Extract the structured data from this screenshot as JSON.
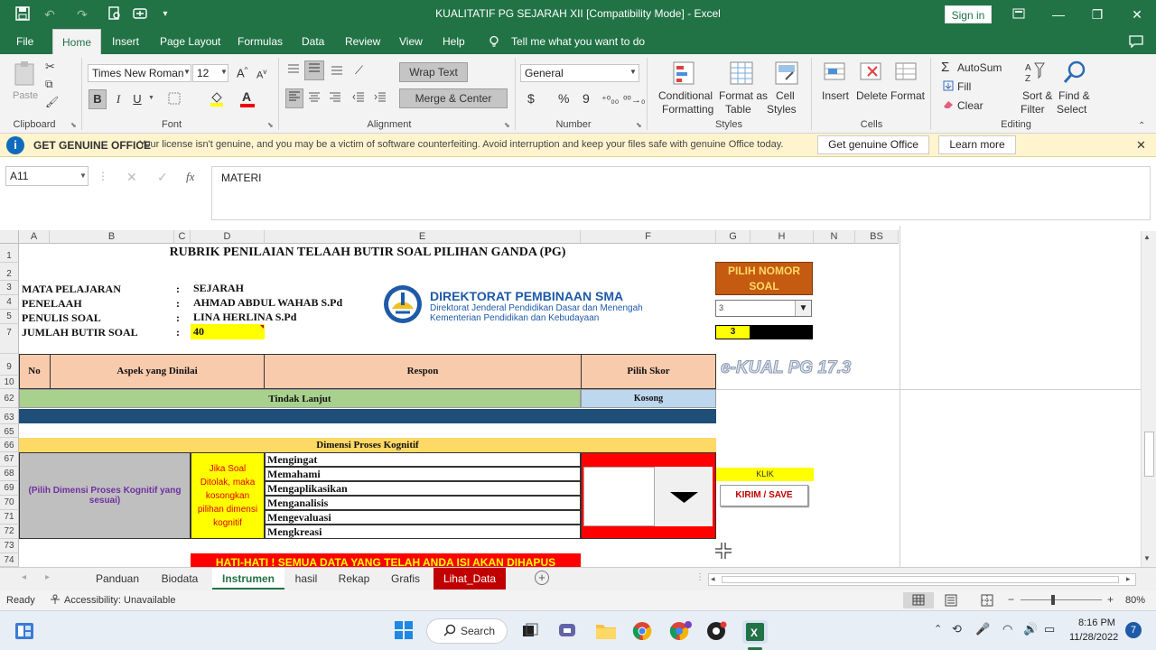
{
  "window": {
    "title": "KUALITATIF PG SEJARAH XII  [Compatibility Mode]  -  Excel",
    "signin": "Sign in"
  },
  "menu": [
    "File",
    "Home",
    "Insert",
    "Page Layout",
    "Formulas",
    "Data",
    "Review",
    "View",
    "Help"
  ],
  "tell_me": "Tell me what you want to do",
  "ribbon": {
    "clipboard": {
      "label": "Clipboard",
      "paste": "Paste"
    },
    "font": {
      "label": "Font",
      "name": "Times New Roman",
      "size": "12",
      "bold": "B",
      "italic": "I",
      "underline": "U"
    },
    "alignment": {
      "label": "Alignment",
      "wrap": "Wrap Text",
      "merge": "Merge & Center"
    },
    "number": {
      "label": "Number",
      "format": "General",
      "currency": "$",
      "percent": "%",
      "comma": "9"
    },
    "styles": {
      "label": "Styles",
      "cond1": "Conditional",
      "cond2": "Formatting",
      "fmt1": "Format as",
      "fmt2": "Table",
      "cell1": "Cell",
      "cell2": "Styles"
    },
    "cells": {
      "label": "Cells",
      "insert": "Insert",
      "delete": "Delete",
      "format": "Format"
    },
    "editing": {
      "label": "Editing",
      "autosum": "AutoSum",
      "fill": "Fill",
      "clear": "Clear",
      "sort1": "Sort &",
      "sort2": "Filter",
      "find1": "Find &",
      "find2": "Select"
    }
  },
  "notification": {
    "title": "GET GENUINE OFFICE",
    "message": "Your license isn't genuine, and you may be a victim of software counterfeiting. Avoid interruption and keep your files safe with genuine Office today.",
    "btn_genuine": "Get genuine Office",
    "btn_learn": "Learn more"
  },
  "formula_bar": {
    "name_box": "A11",
    "fx": "fx",
    "content": "MATERI"
  },
  "columns": [
    "A",
    "B",
    "C",
    "D",
    "E",
    "F",
    "G",
    "H",
    "N",
    "BS"
  ],
  "rows": [
    "1",
    "2",
    "3",
    "4",
    "5",
    "7",
    "9",
    "10",
    "62",
    "63",
    "65",
    "66",
    "67",
    "68",
    "69",
    "70",
    "71",
    "72",
    "73",
    "74"
  ],
  "sheet": {
    "title": "RUBRIK PENILAIAN TELAAH BUTIR SOAL PILIHAN GANDA (PG)",
    "info": [
      {
        "label": "MATA PELAJARAN",
        "colon": ":",
        "value": "SEJARAH"
      },
      {
        "label": "PENELAAH",
        "colon": ":",
        "value": "AHMAD ABDUL WAHAB S.Pd"
      },
      {
        "label": "PENULIS SOAL",
        "colon": ":",
        "value": "LINA HERLINA S.Pd"
      },
      {
        "label": "JUMLAH BUTIR SOAL",
        "colon": ":",
        "value": "40"
      }
    ],
    "logo": {
      "line1": "DIREKTORAT PEMBINAAN SMA",
      "line2": "Direktorat Jenderal Pendidikan Dasar dan Menengah",
      "line3": "Kementerian Pendidikan dan Kebudayaan"
    },
    "pilih_nomor": "PILIH NOMOR SOAL",
    "dropdown_value": "3",
    "nomor_value": "3",
    "watermark": "e-KUAL PG 17.3",
    "headers": {
      "no": "No",
      "aspek": "Aspek yang Dinilai",
      "respon": "Respon",
      "skor": "Pilih Skor"
    },
    "tindak_lanjut": "Tindak Lanjut",
    "kosong": "Kosong",
    "dimensi_title": "Dimensi Proses Kognitif",
    "pilih_dimensi": "(Pilih Dimensi Proses Kognitif yang sesuai)",
    "jika_soal": "Jika Soal Ditolak, maka kosongkan pilihan dimensi kognitif",
    "dimensi_items": [
      "Mengingat",
      "Memahami",
      "Mengaplikasikan",
      "Menganalisis",
      "Mengevaluasi",
      "Mengkreasi"
    ],
    "klik": "KLIK",
    "kirim": "KIRIM / SAVE",
    "warning": "HATI-HATI ! SEMUA DATA YANG TELAH ANDA ISI AKAN DIHAPUS"
  },
  "sheet_tabs": [
    "Panduan",
    "Biodata",
    "Instrumen",
    "hasil",
    "Rekap",
    "Grafis",
    "Lihat_Data"
  ],
  "status": {
    "ready": "Ready",
    "accessibility": "Accessibility: Unavailable",
    "zoom": "80%"
  },
  "taskbar": {
    "search": "Search",
    "time": "8:16 PM",
    "date": "11/28/2022",
    "badge": "7"
  },
  "colors": {
    "excel_green": "#217346",
    "header_peach": "#f8cbad",
    "green_row": "#a9d18e",
    "dark_blue": "#1f4e79",
    "orange": "#c55a11",
    "yellow": "#ffff00",
    "red": "#ff0000"
  }
}
